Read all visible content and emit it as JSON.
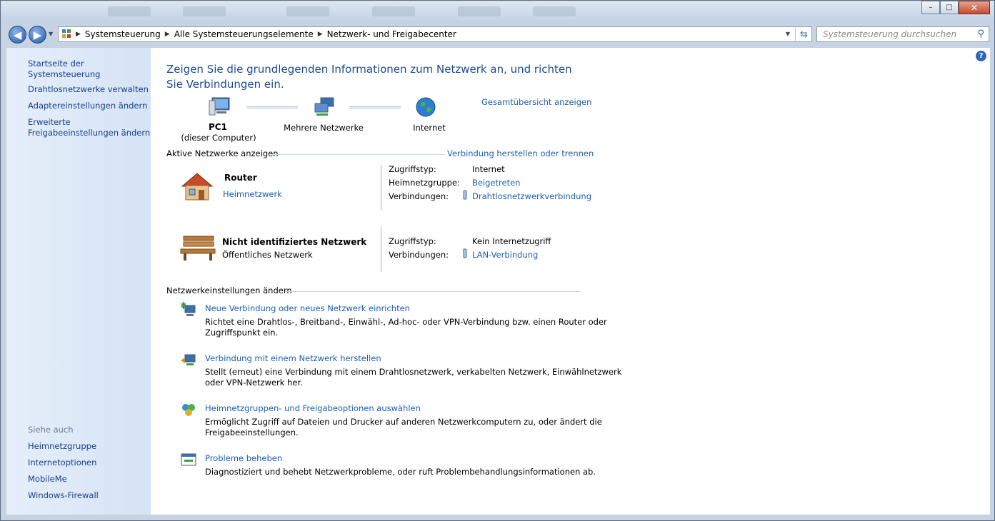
{
  "window": {
    "controls": {
      "minimize": "–",
      "maximize": "□",
      "close": "✕"
    }
  },
  "address": {
    "crumbs": [
      "Systemsteuerung",
      "Alle Systemsteuerungselemente",
      "Netzwerk- und Freigabecenter"
    ],
    "search_placeholder": "Systemsteuerung durchsuchen"
  },
  "sidebar": {
    "items": [
      "Startseite der Systemsteuerung",
      "Drahtlosnetzwerke verwalten",
      "Adaptereinstellungen ändern",
      "Erweiterte",
      "Freigabeeinstellungen ändern"
    ],
    "see_also_title": "Siehe auch",
    "see_also": [
      "Heimnetzgruppe",
      "Internetoptionen",
      "MobileMe",
      "Windows-Firewall"
    ]
  },
  "main": {
    "heading": "Zeigen Sie die grundlegenden Informationen zum Netzwerk an, und richten Sie Verbindungen ein.",
    "overview_link": "Gesamtübersicht anzeigen",
    "map": {
      "pc_name": "PC1",
      "pc_sub": "(dieser Computer)",
      "middle": "Mehrere Netzwerke",
      "internet": "Internet"
    },
    "active_title": "Aktive Netzwerke anzeigen",
    "connect_link": "Verbindung herstellen oder trennen",
    "networks": [
      {
        "name": "Router",
        "type": "Heimnetzwerk",
        "access_label": "Zugriffstyp:",
        "access_value": "Internet",
        "homegroup_label": "Heimnetzgruppe:",
        "homegroup_value": "Beigetreten",
        "conn_label": "Verbindungen:",
        "conn_value": "Drahtlosnetzwerkverbindung"
      },
      {
        "name": "Nicht identifiziertes Netzwerk",
        "type": "Öffentliches Netzwerk",
        "access_label": "Zugriffstyp:",
        "access_value": "Kein Internetzugriff",
        "conn_label": "Verbindungen:",
        "conn_value": "LAN-Verbindung"
      }
    ],
    "settings_title": "Netzwerkeinstellungen ändern",
    "tasks": [
      {
        "title": "Neue Verbindung oder neues Netzwerk einrichten",
        "desc1": "Richtet eine Drahtlos-, Breitband-, Einwähl-, Ad-hoc- oder VPN-Verbindung bzw. einen Router oder",
        "desc2": "Zugriffspunkt ein."
      },
      {
        "title": "Verbindung mit einem Netzwerk herstellen",
        "desc1": "Stellt (erneut) eine Verbindung mit einem Drahtlosnetzwerk, verkabelten Netzwerk, Einwählnetzwerk",
        "desc2": "oder VPN-Netzwerk her."
      },
      {
        "title": "Heimnetzgruppen- und Freigabeoptionen auswählen",
        "desc1": "Ermöglicht Zugriff auf Dateien und Drucker auf anderen Netzwerkcomputern zu, oder ändert die",
        "desc2": "Freigabeeinstellungen."
      },
      {
        "title": "Probleme beheben",
        "desc1": "Diagnostiziert und behebt Netzwerkprobleme, oder ruft Problembehandlungsinformationen ab.",
        "desc2": ""
      }
    ]
  },
  "help_label": "?"
}
